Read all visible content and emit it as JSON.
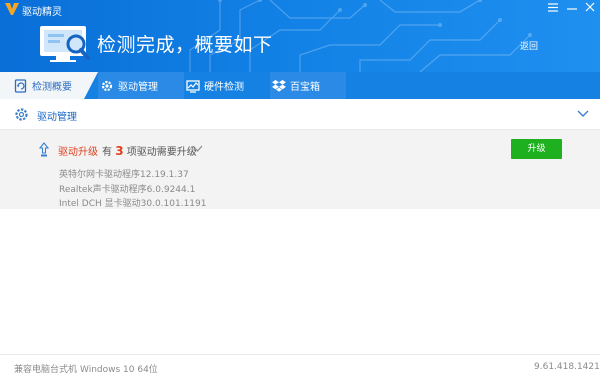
{
  "window": {
    "title": "驱动精灵",
    "controls": [
      "menu-icon",
      "minimize-icon",
      "close-icon"
    ]
  },
  "header": {
    "headline": "检测完成，概要如下",
    "return_label": "返回",
    "bg_color": "#1282e6"
  },
  "tabs": [
    {
      "label": "检测概要",
      "icon": "refresh-doc-icon",
      "active": true
    },
    {
      "label": "驱动管理",
      "icon": "gear-icon",
      "active": false
    },
    {
      "label": "硬件检测",
      "icon": "chart-monitor-icon",
      "active": false
    },
    {
      "label": "百宝箱",
      "icon": "dropbox-icon",
      "active": false
    }
  ],
  "section": {
    "title": "驱动管理",
    "icon": "gear-icon"
  },
  "upgrade": {
    "label": "驱动升级",
    "desc_prefix": "有",
    "count": "3",
    "desc_suffix": "项驱动需要升级",
    "button_label": "升级",
    "button_color": "#1fb01f",
    "items": [
      "英特尔网卡驱动程序12.19.1.37",
      "Realtek声卡驱动程序6.0.9244.1",
      "Intel DCH 显卡驱动30.0.101.1191"
    ]
  },
  "footer": {
    "machine_type": "兼容电脑台式机",
    "os": "Windows 10 64位",
    "version": "9.61.418.1421"
  }
}
